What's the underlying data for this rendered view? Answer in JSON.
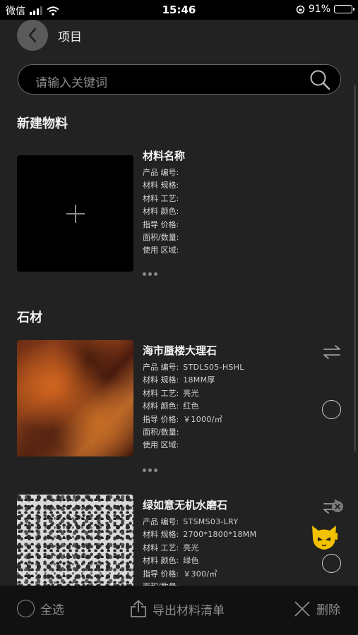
{
  "status_bar": {
    "carrier": "微信",
    "time": "15:46",
    "battery": "91%",
    "battery_level": 0.91
  },
  "header": {
    "title": "项目"
  },
  "search": {
    "placeholder": "请输入关键词"
  },
  "new_material": {
    "section_title": "新建物料",
    "name": "材料名称",
    "fields": [
      {
        "label": "产品 编号:",
        "value": ""
      },
      {
        "label": "材料 规格:",
        "value": ""
      },
      {
        "label": "材料 工艺:",
        "value": ""
      },
      {
        "label": "材料 颜色:",
        "value": ""
      },
      {
        "label": "指导 价格:",
        "value": ""
      },
      {
        "label": "面积/数量:",
        "value": ""
      },
      {
        "label": "使用 区域:",
        "value": ""
      }
    ]
  },
  "stone": {
    "section_title": "石材",
    "items": [
      {
        "name": "海市蜃楼大理石",
        "fields": [
          {
            "label": "产品 编号:",
            "value": "STDLS05-HSHL"
          },
          {
            "label": "材料 规格:",
            "value": "18MM厚"
          },
          {
            "label": "材料 工艺:",
            "value": "亮光"
          },
          {
            "label": "材料 颜色:",
            "value": "红色"
          },
          {
            "label": "指导 价格:",
            "value": "￥1000/㎡"
          },
          {
            "label": "面积/数量:",
            "value": ""
          },
          {
            "label": "使用 区域:",
            "value": ""
          }
        ]
      },
      {
        "name": "绿如意无机水磨石",
        "fields": [
          {
            "label": "产品 编号:",
            "value": "STSMS03-LRY"
          },
          {
            "label": "材料 规格:",
            "value": "2700*1800*18MM"
          },
          {
            "label": "材料 工艺:",
            "value": "亮光"
          },
          {
            "label": "材料 颜色:",
            "value": "绿色"
          },
          {
            "label": "指导 价格:",
            "value": "￥300/㎡"
          },
          {
            "label": "面积/数量:",
            "value": ""
          }
        ]
      }
    ]
  },
  "bottom_bar": {
    "select_all": "全选",
    "export": "导出材料清单",
    "delete": "删除"
  },
  "colors": {
    "background": "#222222",
    "bottom_bar": "#111111",
    "mascot": "#f2c200"
  }
}
